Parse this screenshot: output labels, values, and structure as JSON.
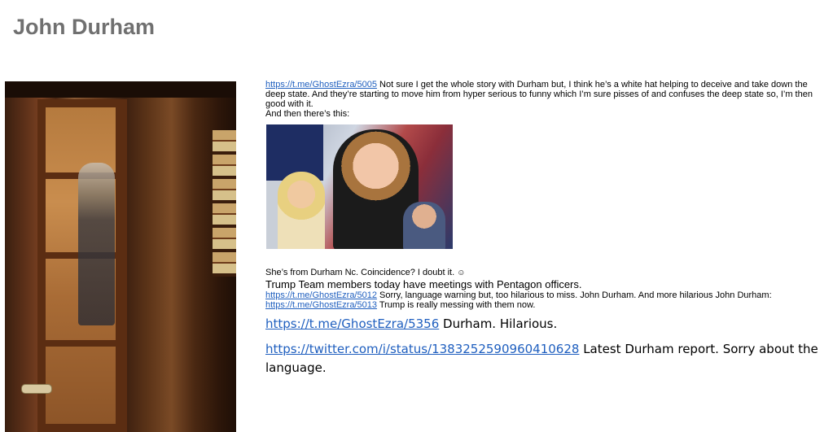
{
  "page": {
    "title": "John Durham"
  },
  "post": {
    "line1_link": "https://t.me/GhostEzra/5005",
    "line1_text": " Not sure I get the whole story with Durham but, I think he’s a white hat helping to deceive and take down the deep state.  And they’re starting to move him from hyper serious to funny which I’m sure pisses of and confuses the deep state so, I’m then good with it.",
    "line2_text": "And then there’s this:",
    "caption_text": "She’s from Durham Nc. Coincidence? I doubt it. ",
    "caption_emoji": "☺",
    "trump_line": "Trump Team members today have meetings with Pentagon officers.",
    "link5012": "https://t.me/GhostEzra/5012",
    "text5012": " Sorry, language warning but, too hilarious to miss. John Durham.  And more hilarious John Durham: ",
    "link5013": "https://t.me/GhostEzra/5013",
    "text5013": " Trump is really messing with them now.",
    "link5356": "https://t.me/GhostEzra/5356",
    "text5356": " Durham.  Hilarious.",
    "twitter_link": "https://twitter.com/i/status/1383252590960410628",
    "twitter_text": " Latest Durham report. Sorry about the language."
  },
  "colors": {
    "link": "#1f5fbf",
    "title": "#707070"
  }
}
